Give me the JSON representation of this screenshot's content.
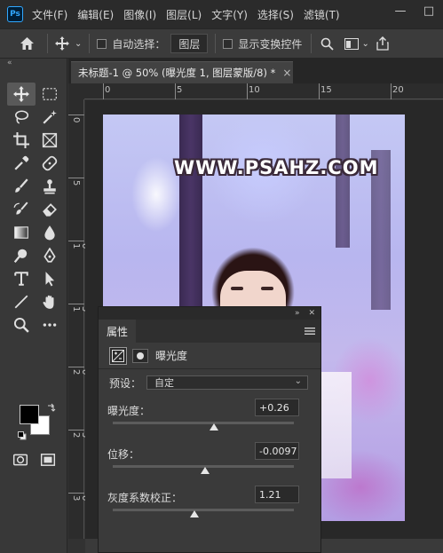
{
  "app": {
    "logo": "Ps"
  },
  "menu": [
    "文件(F)",
    "编辑(E)",
    "图像(I)",
    "图层(L)",
    "文字(Y)",
    "选择(S)",
    "滤镜(T)"
  ],
  "window_controls": {
    "minimize": "—",
    "restore": "□"
  },
  "options_bar": {
    "auto_select_label": "自动选择：",
    "auto_select_target": "图层",
    "show_transform_label": "显示变换控件"
  },
  "document_tab": {
    "title": "未标题-1 @ 50% (曝光度 1, 图层蒙版/8) *",
    "close": "×"
  },
  "ruler": {
    "horizontal": [
      "0",
      "5",
      "10",
      "15",
      "20",
      "25"
    ],
    "vertical": [
      "0",
      "5",
      "1 0",
      "1 5",
      "2 0",
      "2 5",
      "3 0"
    ]
  },
  "canvas": {
    "watermark": "WWW.PSAHZ.COM"
  },
  "properties_panel": {
    "tab_label": "属性",
    "adjustment_title": "曝光度",
    "preset_label": "预设：",
    "preset_value": "自定",
    "params": [
      {
        "label": "曝光度：",
        "value": "+0.26",
        "level": 0.56
      },
      {
        "label": "位移：",
        "value": "-0.0097",
        "level": 0.51
      },
      {
        "label": "灰度系数校正：",
        "value": "1.21",
        "level": 0.45
      }
    ]
  },
  "colors": {
    "foreground": "#000000",
    "background": "#ffffff",
    "accent": "#31a8ff"
  }
}
